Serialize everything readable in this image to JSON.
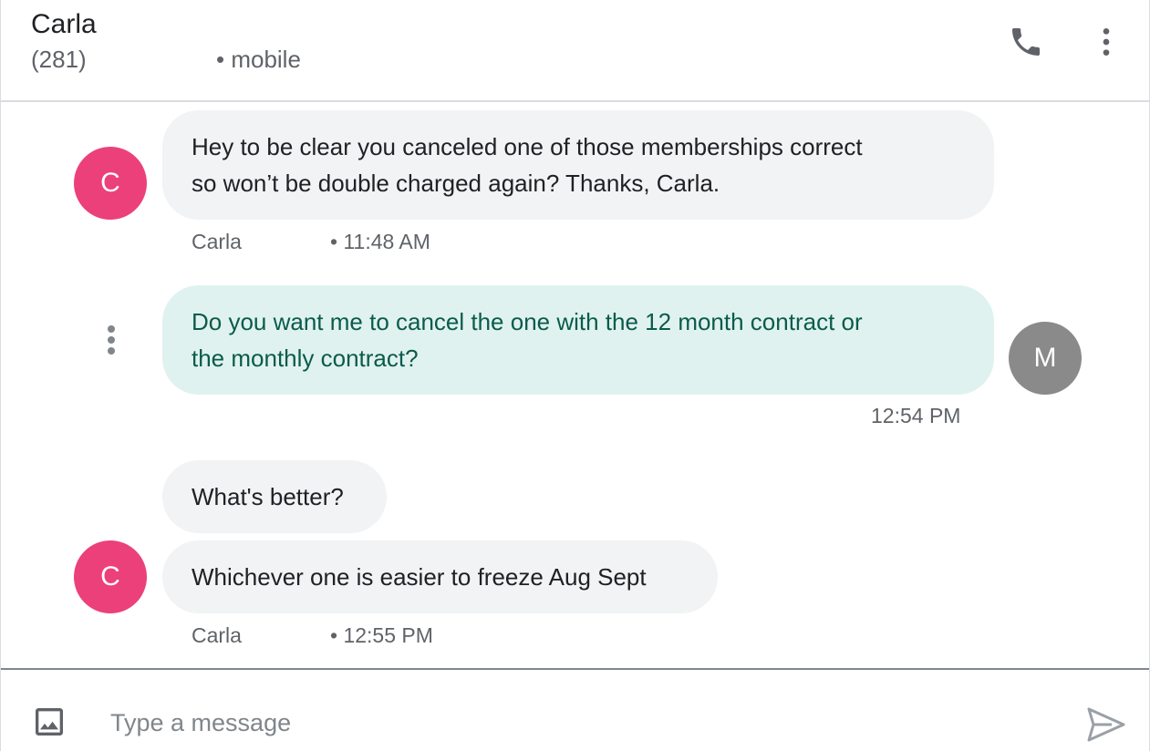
{
  "header": {
    "name": "Carla",
    "number": "(281)",
    "number_type": "• mobile",
    "icons": {
      "call": "phone-icon",
      "more": "more-vert-icon"
    }
  },
  "messages": [
    {
      "direction": "incoming",
      "avatar_initial": "C",
      "lines": [
        "Hey to be clear you canceled one of those memberships correct",
        "so won’t be double charged again? Thanks, Carla."
      ],
      "sender": "Carla",
      "time": "• 11:48 AM"
    },
    {
      "direction": "outgoing",
      "avatar_initial": "M",
      "lines": [
        "Do you want me to cancel the one with the 12 month contract or",
        "the monthly contract?"
      ],
      "time": "12:54 PM"
    },
    {
      "direction": "incoming",
      "lines": [
        "What's better?"
      ]
    },
    {
      "direction": "incoming",
      "avatar_initial": "C",
      "lines": [
        "Whichever one is easier to freeze Aug Sept"
      ],
      "sender": "Carla",
      "time": "• 12:55 PM"
    }
  ],
  "compose": {
    "placeholder": "Type a message",
    "value": "",
    "icons": {
      "attach": "image-icon",
      "send": "send-icon"
    }
  },
  "colors": {
    "incoming_avatar": "#ec407a",
    "outgoing_avatar": "#8a8a8a",
    "incoming_bubble": "#f1f3f4",
    "outgoing_bubble": "#e0f2ef",
    "outgoing_text": "#0a5b4c"
  }
}
